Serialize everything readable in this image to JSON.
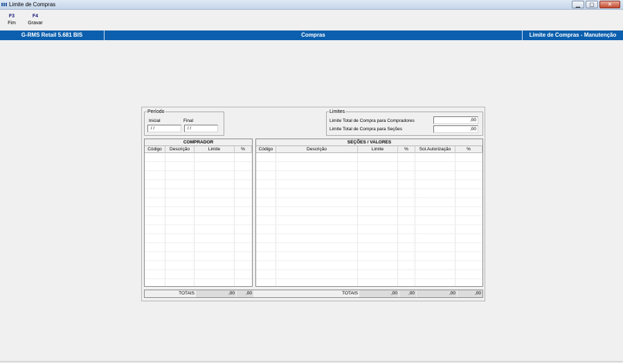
{
  "window": {
    "title": "Limite de Compras",
    "controls": {
      "minimize": "▁",
      "maximize": "▢",
      "close": "✕"
    }
  },
  "toolbar": {
    "keys": [
      {
        "key": "F3",
        "label": "Fim"
      },
      {
        "key": "F4",
        "label": "Gravar"
      }
    ]
  },
  "header": {
    "app": "G-RMS Retail 5.681 BIS",
    "module": "Compras",
    "screen": "Limite de Compras - Manutenção"
  },
  "periodo": {
    "legend": "Período",
    "inicial_label": "Inicial",
    "inicial_value": " / /",
    "final_label": "Final",
    "final_value": " / /"
  },
  "limites": {
    "legend": "Limites",
    "compradores_label": "Limite Total de Compra para Compradores",
    "compradores_value": ",00",
    "secoes_label": "Limite Total de Compra para Seções",
    "secoes_value": ",00"
  },
  "comprador_grid": {
    "title": "COMPRADOR",
    "columns": [
      "Código",
      "Descrição",
      "Limite",
      "%"
    ]
  },
  "secoes_grid": {
    "title": "SEÇÕES / VALORES",
    "columns": [
      "Código",
      "Descrição",
      "Limite",
      "%",
      "Sol.Autorização",
      "%"
    ]
  },
  "totals_left": {
    "label": "TOTAIS",
    "limite": ",00",
    "pct": ",00"
  },
  "totals_right": {
    "label": "TOTAIS",
    "limite": ",00",
    "pct": ",00",
    "sol": ",00",
    "pct2": ",00"
  }
}
